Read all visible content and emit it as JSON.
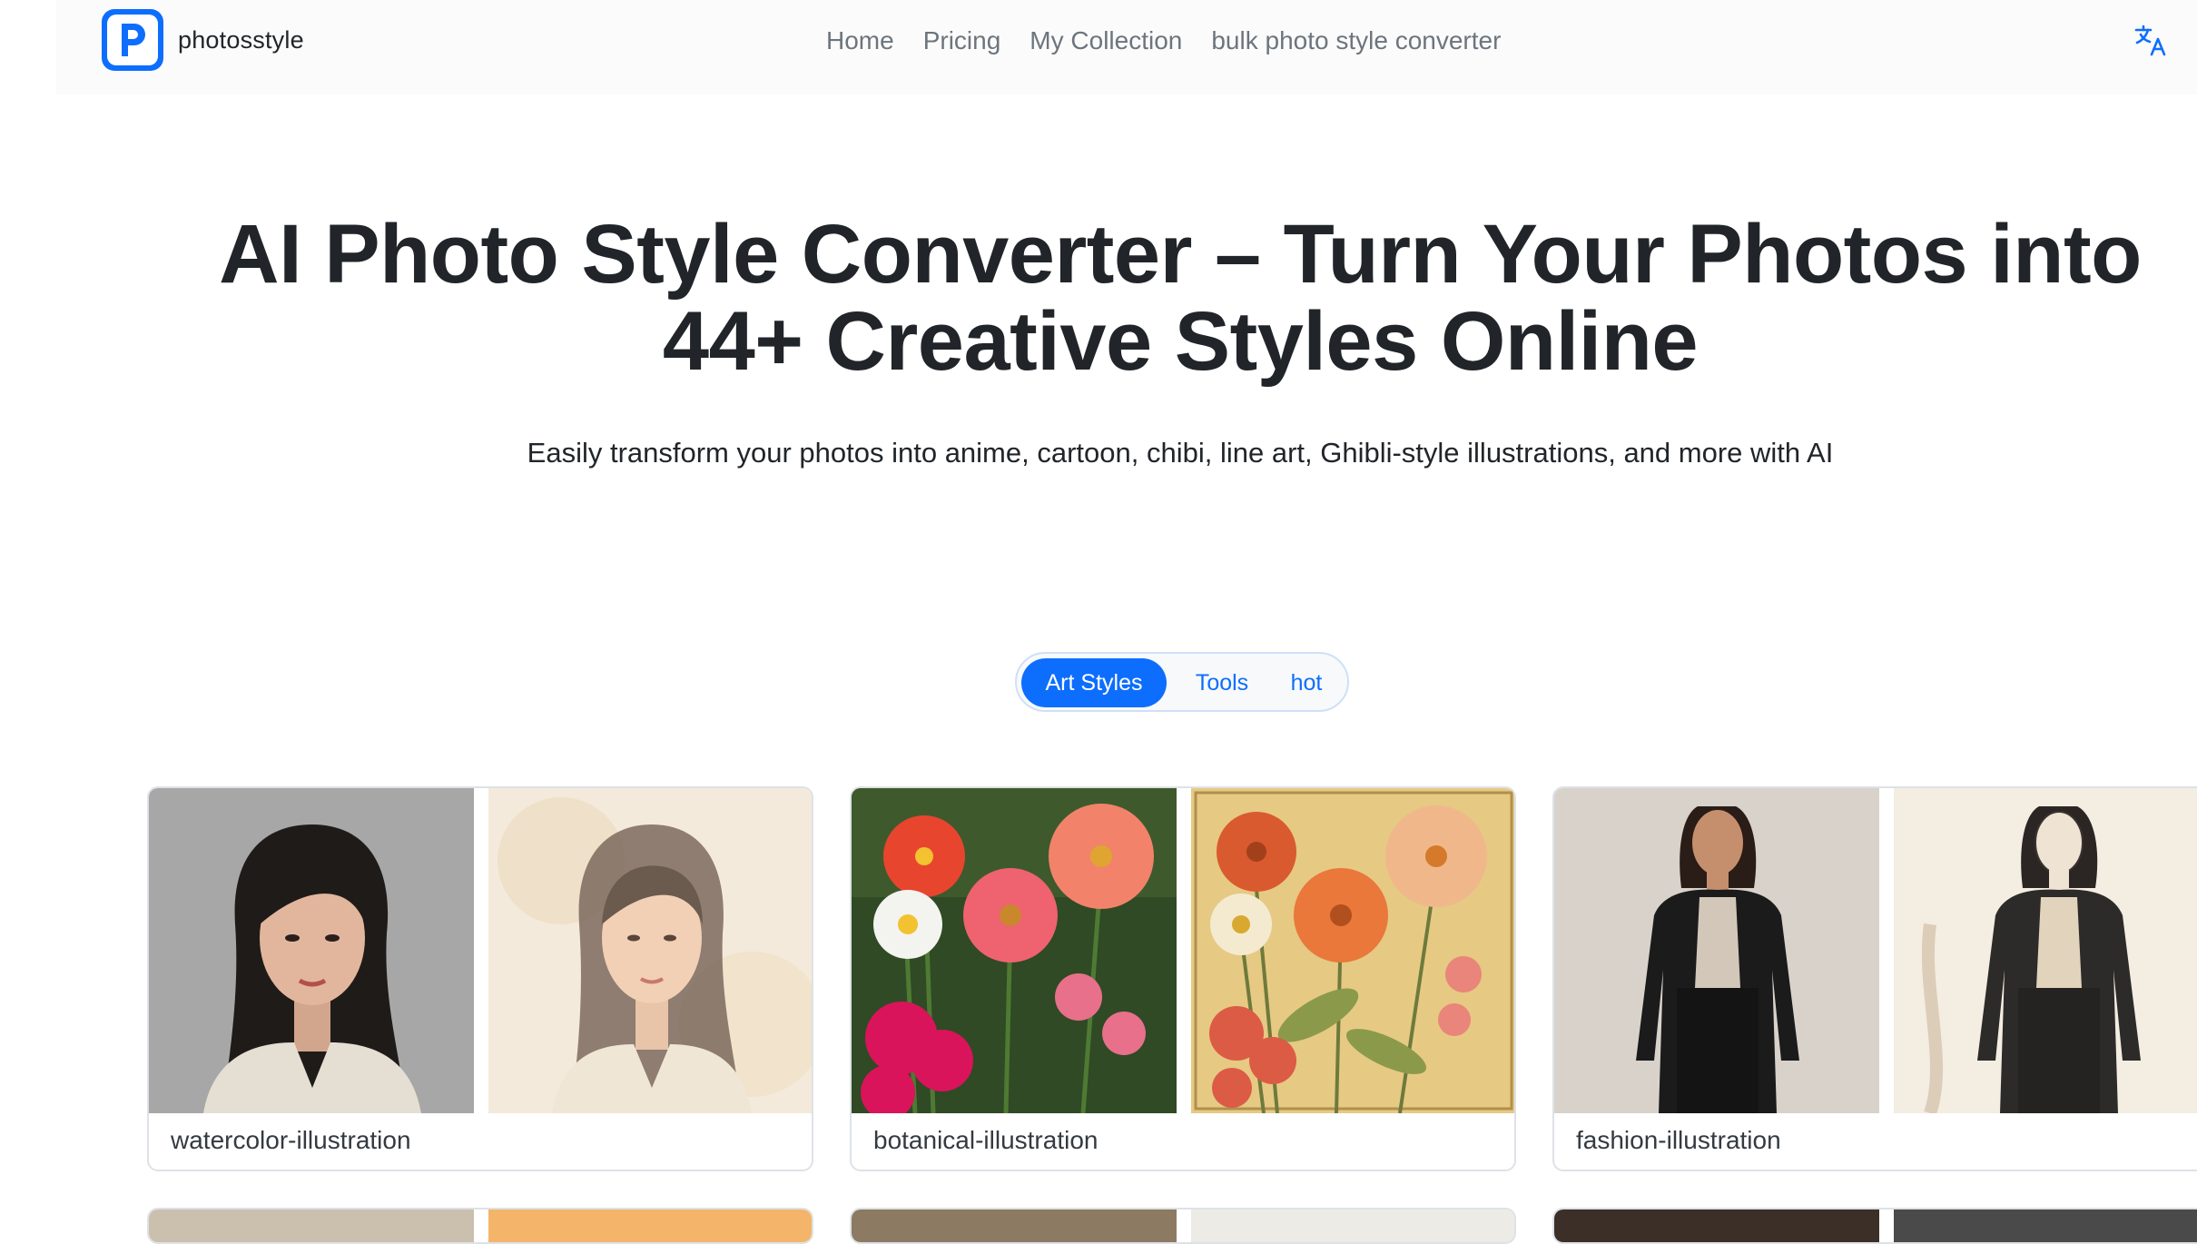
{
  "brand": {
    "name": "photosstyle",
    "logo_letter": "p",
    "logo_color": "#0d6efd"
  },
  "nav": {
    "links": [
      "Home",
      "Pricing",
      "My Collection",
      "bulk photo style converter"
    ],
    "translate_icon": "translate-icon"
  },
  "hero": {
    "title_line1": "AI Photo Style Converter – Turn Your Photos into",
    "title_line2": "44+ Creative Styles Online",
    "subtitle": "Easily transform your photos into anime, cartoon, chibi, line art, Ghibli-style illustrations, and more with AI"
  },
  "tabs": {
    "items": [
      "Art Styles",
      "Tools",
      "hot"
    ],
    "active": "Art Styles",
    "accent": "#0d6efd"
  },
  "cards": [
    {
      "label": "watercolor-illustration",
      "before": "portrait-photo",
      "after": "watercolor-portrait"
    },
    {
      "label": "botanical-illustration",
      "before": "flowers-photo",
      "after": "botanical-drawing"
    },
    {
      "label": "fashion-illustration",
      "before": "fashion-photo",
      "after": "fashion-sketch"
    }
  ]
}
